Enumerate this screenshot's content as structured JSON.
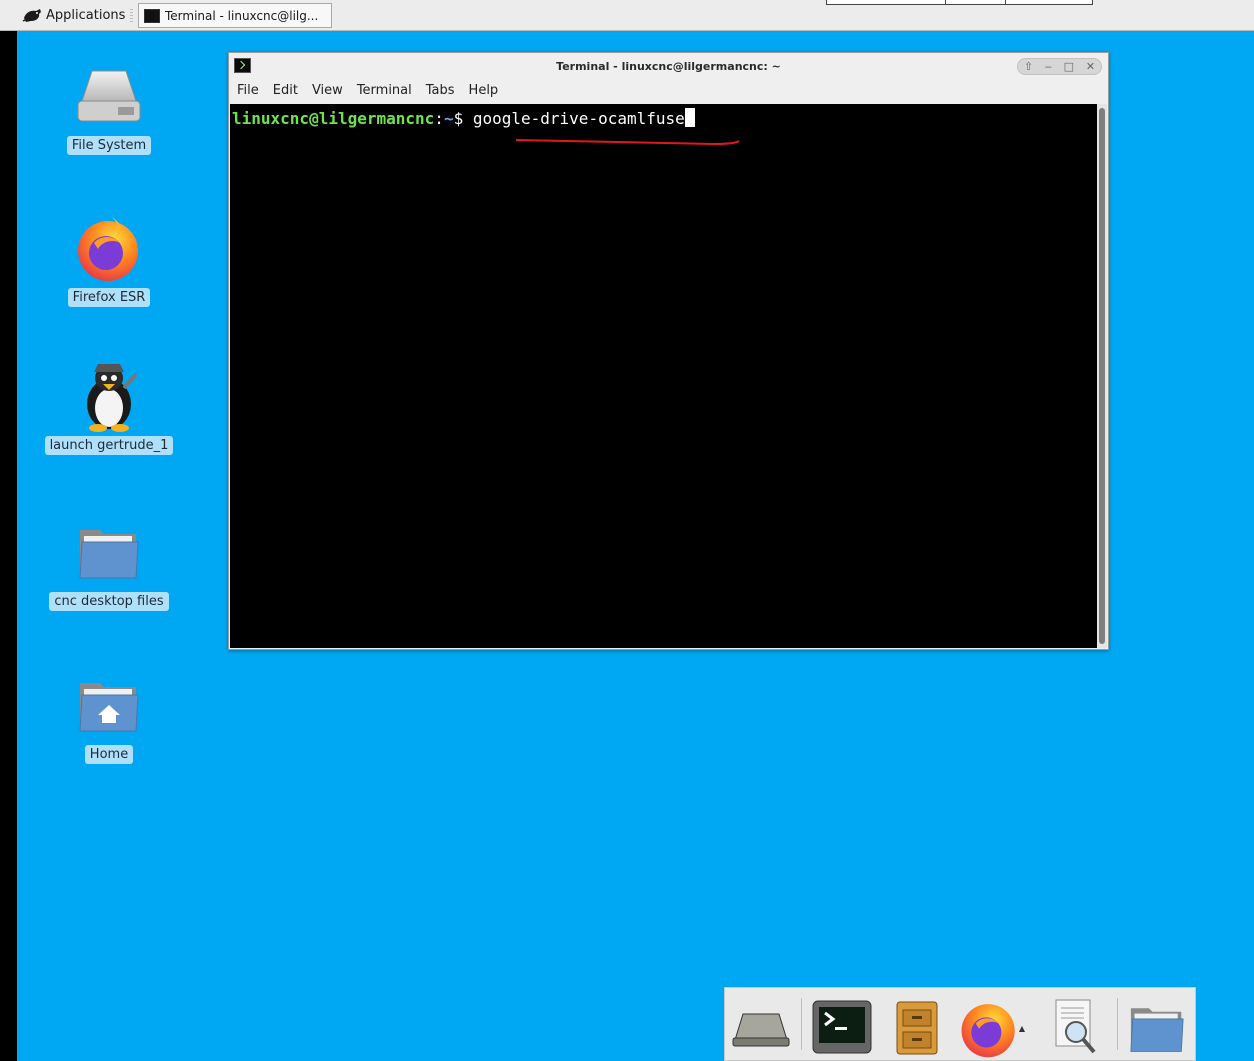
{
  "top_panel": {
    "applications_label": "Applications",
    "task_button_label": "Terminal - linuxcnc@lilg..."
  },
  "desktop_icons": [
    {
      "label": "File System",
      "icon": "drive-harddisk-icon"
    },
    {
      "label": "Firefox ESR",
      "icon": "firefox-icon"
    },
    {
      "label": "launch gertrude_1",
      "icon": "tux-penguin-icon"
    },
    {
      "label": "cnc desktop files",
      "icon": "folder-icon"
    },
    {
      "label": "Home",
      "icon": "home-folder-icon"
    }
  ],
  "terminal": {
    "title": "Terminal - linuxcnc@lilgermancnc: ~",
    "menu": [
      "File",
      "Edit",
      "View",
      "Terminal",
      "Tabs",
      "Help"
    ],
    "prompt_user": "linuxcnc@lilgermancnc",
    "prompt_sep": ":",
    "prompt_path": "~",
    "prompt_symbol": "$ ",
    "command": "google-drive-ocamlfuse"
  },
  "dock": {
    "items": [
      "drive-icon",
      "terminal-icon",
      "file-cabinet-icon",
      "firefox-icon",
      "document-viewer-icon",
      "folder-icon"
    ]
  },
  "colors": {
    "desktop": "#00a8f3",
    "prompt_user": "#6fe34c",
    "prompt_path": "#5fa8ff",
    "annotation": "#e01818"
  }
}
